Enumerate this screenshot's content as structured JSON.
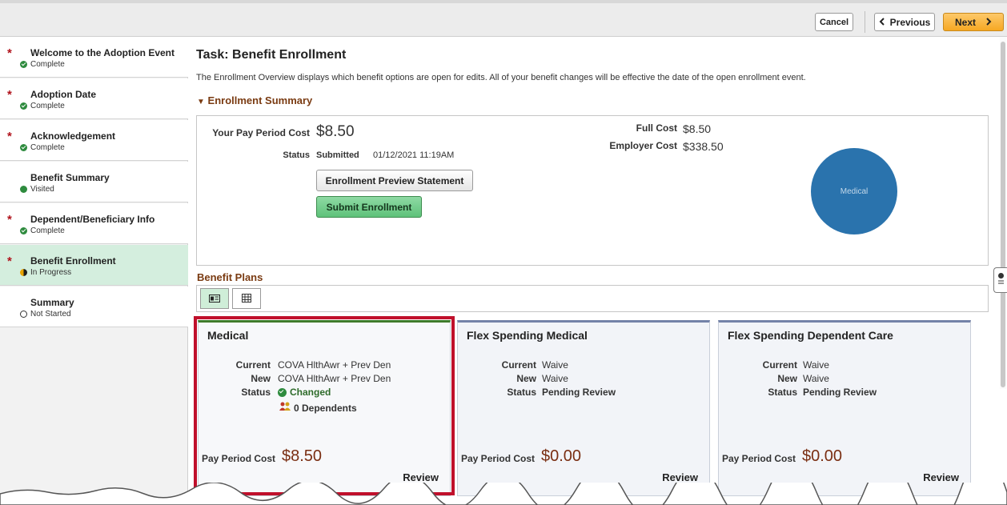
{
  "toolbar": {
    "cancel_label": "Cancel",
    "previous_label": "Previous",
    "next_label": "Next"
  },
  "sidebar": {
    "items": [
      {
        "title": "Welcome to the Adoption Event",
        "status": "Complete",
        "required": true,
        "state": "complete"
      },
      {
        "title": "Adoption Date",
        "status": "Complete",
        "required": true,
        "state": "complete"
      },
      {
        "title": "Acknowledgement",
        "status": "Complete",
        "required": true,
        "state": "complete"
      },
      {
        "title": "Benefit Summary",
        "status": "Visited",
        "required": false,
        "state": "visited"
      },
      {
        "title": "Dependent/Beneficiary Info",
        "status": "Complete",
        "required": true,
        "state": "complete"
      },
      {
        "title": "Benefit Enrollment",
        "status": "In Progress",
        "required": true,
        "state": "in-progress",
        "active": true
      },
      {
        "title": "Summary",
        "status": "Not Started",
        "required": false,
        "state": "not-started"
      }
    ],
    "required_marker": "*"
  },
  "main": {
    "title": "Task: Benefit Enrollment",
    "intro": "The Enrollment Overview displays which benefit options are open for edits. All of your benefit changes will be effective the date of the open enrollment event.",
    "summary_section": "Enrollment Summary",
    "pay_period_cost_label": "Your Pay Period Cost",
    "pay_period_cost": "$8.50",
    "status_label": "Status",
    "status_value": "Submitted",
    "status_date": "01/12/2021 11:19AM",
    "full_cost_label": "Full Cost",
    "full_cost": "$8.50",
    "employer_cost_label": "Employer Cost",
    "employer_cost": "$338.50",
    "preview_button": "Enrollment Preview Statement",
    "submit_button": "Submit Enrollment",
    "pie_label": "Medical",
    "pie_color": "#2a73ad",
    "plans_section": "Benefit Plans"
  },
  "cards": [
    {
      "title": "Medical",
      "current_label": "Current",
      "current": "COVA HlthAwr + Prev Den",
      "new_label": "New",
      "new": "COVA HlthAwr + Prev Den",
      "status_label": "Status",
      "status": "Changed",
      "dependents": "0 Dependents",
      "cost_label": "Pay Period Cost",
      "cost": "$8.50",
      "review": "Review"
    },
    {
      "title": "Flex Spending Medical",
      "current_label": "Current",
      "current": "Waive",
      "new_label": "New",
      "new": "Waive",
      "status_label": "Status",
      "status": "Pending Review",
      "cost_label": "Pay Period Cost",
      "cost": "$0.00",
      "review": "Review"
    },
    {
      "title": "Flex Spending Dependent Care",
      "current_label": "Current",
      "current": "Waive",
      "new_label": "New",
      "new": "Waive",
      "status_label": "Status",
      "status": "Pending Review",
      "cost_label": "Pay Period Cost",
      "cost": "$0.00",
      "review": "Review"
    }
  ],
  "colors": {
    "accent_brown": "#7a3b12",
    "active_nav": "#d4eede",
    "highlight_red": "#c0102b",
    "next_orange": "#f6a823"
  }
}
